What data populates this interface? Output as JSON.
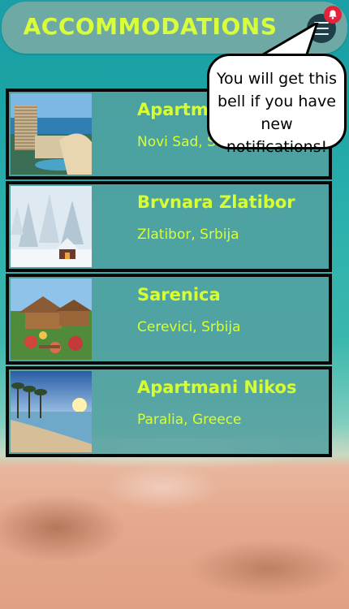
{
  "header": {
    "title": "ACCOMMODATIONS"
  },
  "icons": {
    "menu": "hamburger-menu-icon",
    "notification": "bell-icon",
    "notification_color": "#e4233a"
  },
  "colors": {
    "accent_text": "#d8ff2f",
    "card_border": "#070707"
  },
  "accommodations": [
    {
      "name": "Apartm",
      "location": "Novi Sad, S"
    },
    {
      "name": "Brvnara Zlatibor",
      "location": "Zlatibor, Srbija"
    },
    {
      "name": "Sarenica",
      "location": "Cerevici, Srbija"
    },
    {
      "name": "Apartmani Nikos",
      "location": "Paralia, Greece"
    }
  ],
  "callout": {
    "line1": "You will get this",
    "line2": "bell if you have",
    "line3": "new notifications!"
  }
}
